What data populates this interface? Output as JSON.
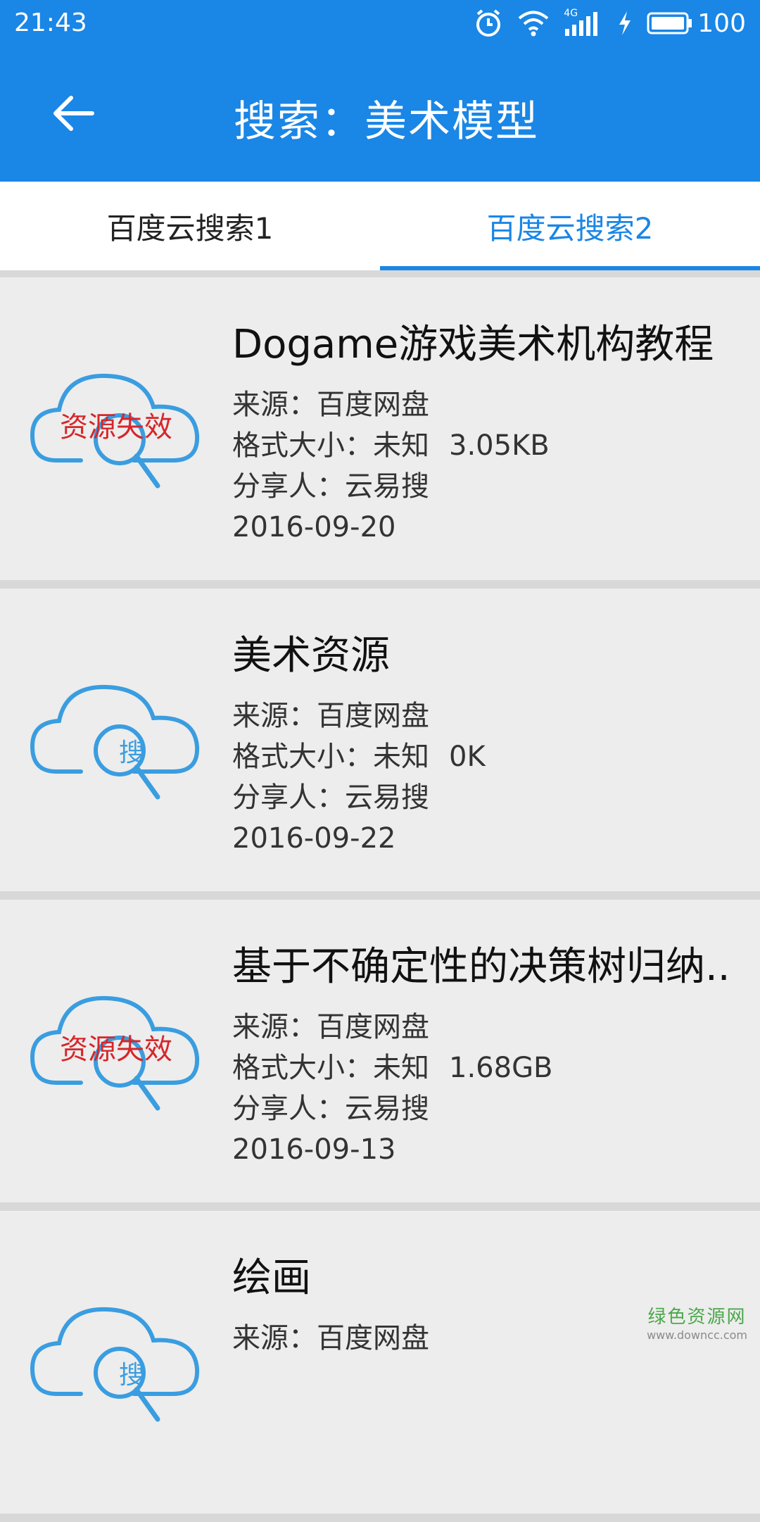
{
  "status": {
    "time": "21:43",
    "network": "4G",
    "battery": "100"
  },
  "header": {
    "title": "搜索：美术模型"
  },
  "tabs": [
    {
      "label": "百度云搜索1",
      "active": false
    },
    {
      "label": "百度云搜索2",
      "active": true
    }
  ],
  "results": [
    {
      "title": "Dogame游戏美术机构教程",
      "source": "来源：百度网盘",
      "size_label": "格式大小：未知",
      "size": "3.05KB",
      "sharer": "分享人：云易搜",
      "date": "2016-09-20",
      "badge": "资源失效"
    },
    {
      "title": "美术资源",
      "source": "来源：百度网盘",
      "size_label": "格式大小：未知",
      "size": "0K",
      "sharer": "分享人：云易搜",
      "date": "2016-09-22",
      "badge": "搜"
    },
    {
      "title": "基于不确定性的决策树归纳..",
      "source": "来源：百度网盘",
      "size_label": "格式大小：未知",
      "size": "1.68GB",
      "sharer": "分享人：云易搜",
      "date": "2016-09-13",
      "badge": "资源失效"
    },
    {
      "title": "绘画",
      "source": "来源：百度网盘",
      "badge": "搜"
    }
  ],
  "watermark": {
    "cn": "绿色资源网",
    "url": "www.downcc.com"
  },
  "colors": {
    "primary": "#1a86e6",
    "icon_blue": "#3a9de0",
    "fail_red": "#d6262a",
    "card_bg": "#ededed"
  }
}
